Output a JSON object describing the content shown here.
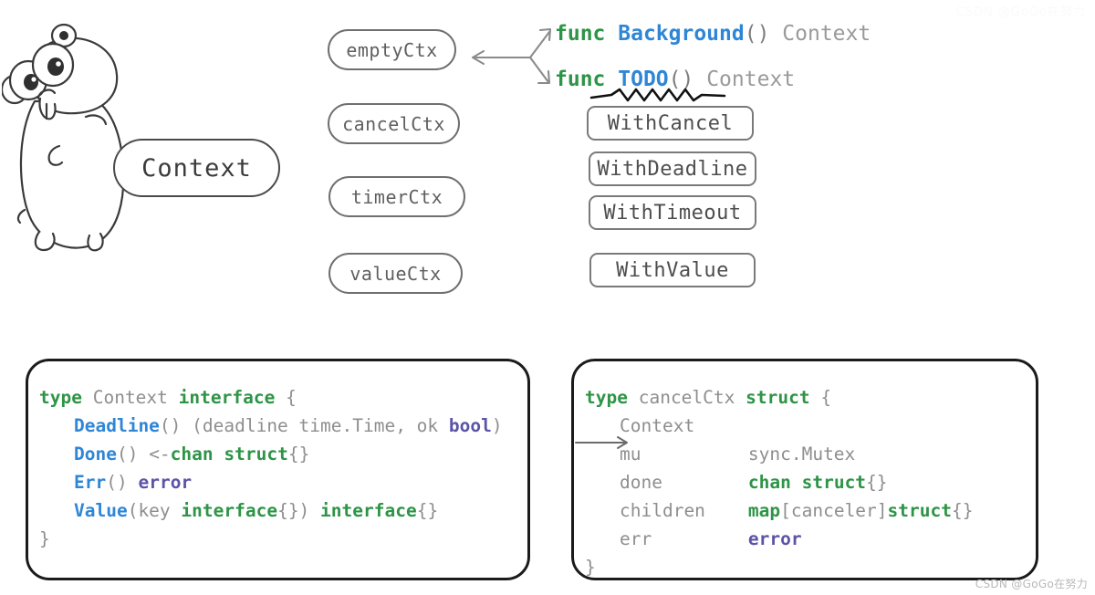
{
  "mascot": {
    "alt": "go-gopher"
  },
  "context_pill": {
    "label": "Context"
  },
  "ctx_types": [
    {
      "label": "emptyCtx"
    },
    {
      "label": "cancelCtx"
    },
    {
      "label": "timerCtx"
    },
    {
      "label": "valueCtx"
    }
  ],
  "funcs": [
    {
      "kw": "func",
      "name": "Background",
      "paren": "()",
      "ret": "Context",
      "underline": false
    },
    {
      "kw": "func",
      "name": "TODO",
      "paren": "()",
      "ret": "Context",
      "underline": true
    }
  ],
  "with_boxes": [
    {
      "label": "WithCancel"
    },
    {
      "label": "WithDeadline"
    },
    {
      "label": "WithTimeout"
    },
    {
      "label": "WithValue"
    }
  ],
  "context_interface": {
    "title": "type Context interface {",
    "lines": {
      "l0_kw": "type",
      "l0_name": "Context",
      "l0_iface": "interface",
      "l0_brace": "{",
      "l1_fn": "Deadline",
      "l1_rest": "() (deadline time.Time, ok ",
      "l1_bool": "bool",
      "l1_close": ")",
      "l2_fn": "Done",
      "l2_mid": "() <-",
      "l2_chan": "chan",
      "l2_sp": " ",
      "l2_struct": "struct",
      "l2_end": "{}",
      "l3_fn": "Err",
      "l3_paren": "() ",
      "l3_err": "error",
      "l4_fn": "Value",
      "l4_a": "(key ",
      "l4_iface1": "interface",
      "l4_b": "{}) ",
      "l4_iface2": "interface",
      "l4_c": "{}",
      "l5_close": "}"
    }
  },
  "cancel_struct": {
    "title": "type cancelCtx struct {",
    "lines": {
      "l0_kw": "type",
      "l0_name": "cancelCtx",
      "l0_struct": "struct",
      "l0_brace": "{",
      "l1_field": "Context",
      "l2_field": "mu",
      "l2_type": "sync.Mutex",
      "l3_field": "done",
      "l3_chan": "chan",
      "l3_struct": "struct",
      "l3_end": "{}",
      "l4_field": "children",
      "l4_map": "map",
      "l4_key": "[canceler]",
      "l4_struct": "struct",
      "l4_end": "{}",
      "l5_field": "err",
      "l5_type": "error",
      "l6_close": "}"
    }
  },
  "watermarks": {
    "bottom_right": "CSDN @GoGo在努力",
    "top_right": "CSDN @GoGo在努力"
  },
  "colors": {
    "keyword_green": "#2e9447",
    "func_blue": "#2f86d6",
    "type_purple": "#5b54a8",
    "plain_gray": "#8e8e8e",
    "outline_gray": "#6f6f6f",
    "box_black": "#1b1b1b"
  }
}
